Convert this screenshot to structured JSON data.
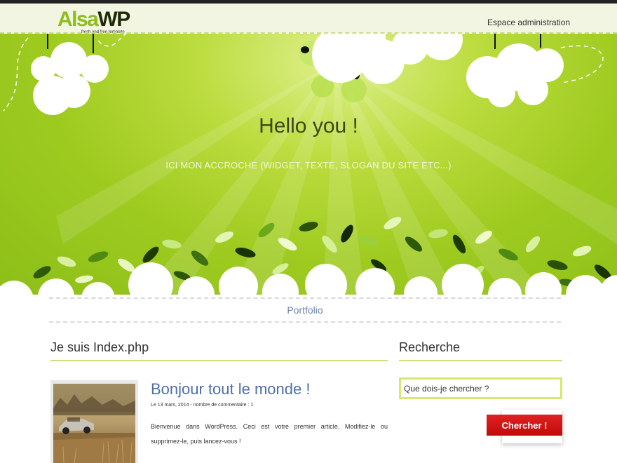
{
  "header": {
    "logo_main_part1": "Alsa",
    "logo_main_part2": "WP",
    "logo_tagline": "fresh and free template",
    "admin_link": "Espace administration"
  },
  "hero": {
    "title": "Hello you !",
    "subtitle": "ICI MON ACCROCHE (WIDGET, TEXTE, SLOGAN DU SITE ETC...)"
  },
  "nav": {
    "items": [
      {
        "label": "Portfolio"
      }
    ]
  },
  "main": {
    "title": "Je suis Index.php",
    "post": {
      "title": "Bonjour tout le monde !",
      "meta": "Le 13 mars, 2014 - nombre de commentaire : 1",
      "excerpt": "Bienvenue dans WordPress. Ceci est votre premier article. Modifiez-le ou supprimez-le, puis lancez-vous !"
    }
  },
  "sidebar": {
    "title": "Recherche",
    "search_placeholder": "Que dois-je chercher ?",
    "search_button": "Chercher !"
  },
  "colors": {
    "accent_green": "#8dbd1c",
    "hero_green": "#9fcb20",
    "link_blue": "#4f6faa",
    "button_red": "#d11616"
  }
}
